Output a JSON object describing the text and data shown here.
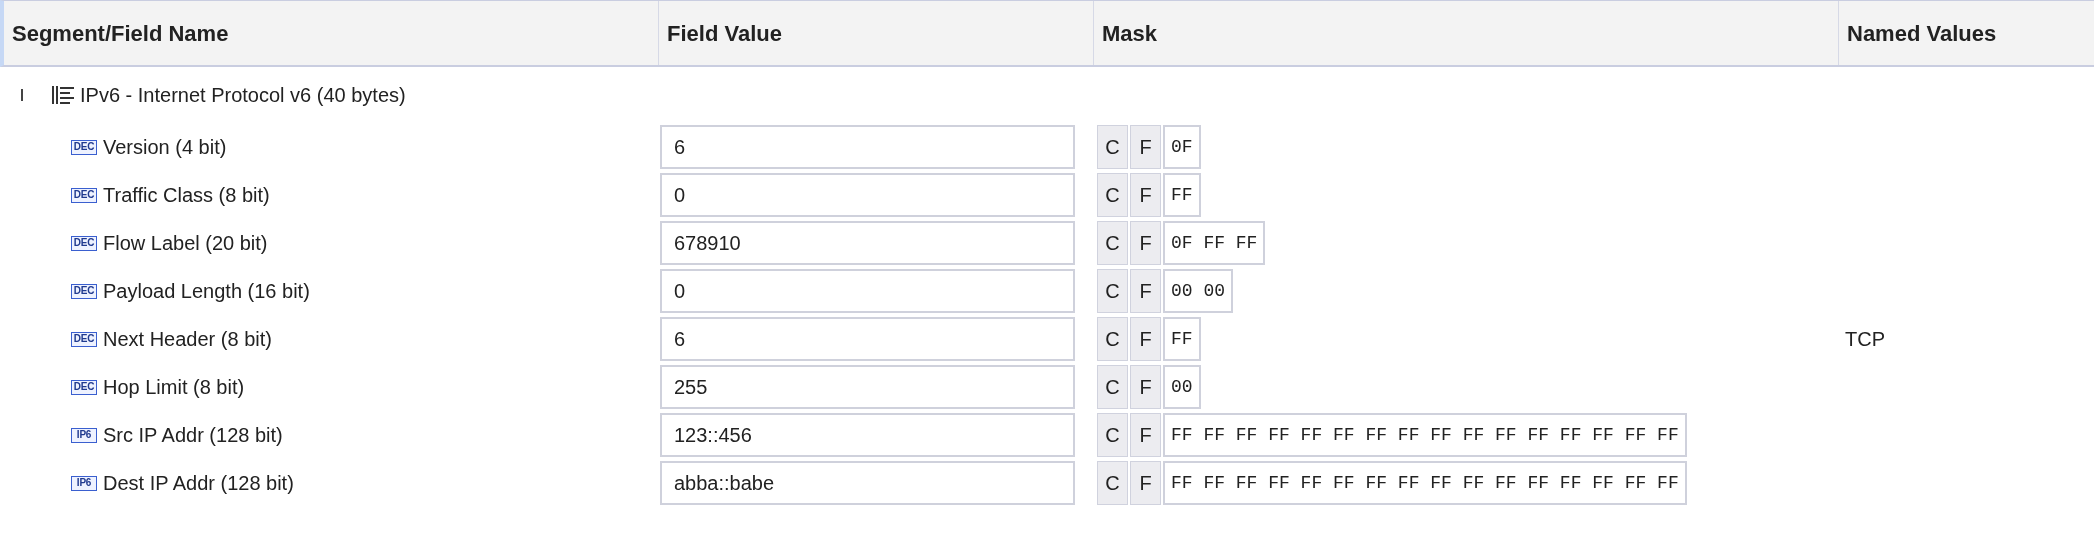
{
  "table": {
    "columns": [
      "Segment/Field Name",
      "Field Value",
      "Mask",
      "Named Values"
    ],
    "segment": {
      "name": "IPv6 - Internet Protocol v6 (40 bytes)",
      "expanded": true,
      "fields": [
        {
          "badge": "DEC",
          "name": "Version (4 bit)",
          "value": "6",
          "mask_buttons": [
            "C",
            "F"
          ],
          "mask": "0F"
        },
        {
          "badge": "DEC",
          "name": "Traffic Class (8 bit)",
          "value": "0",
          "mask_buttons": [
            "C",
            "F"
          ],
          "mask": "FF"
        },
        {
          "badge": "DEC",
          "name": "Flow Label (20 bit)",
          "value": "678910",
          "mask_buttons": [
            "C",
            "F"
          ],
          "mask": "0F FF FF"
        },
        {
          "badge": "DEC",
          "name": "Payload Length (16 bit)",
          "value": "0",
          "mask_buttons": [
            "C",
            "F"
          ],
          "mask": "00 00"
        },
        {
          "badge": "DEC",
          "name": "Next Header (8 bit)",
          "value": "6",
          "mask_buttons": [
            "C",
            "F"
          ],
          "mask": "FF",
          "named_value": "TCP"
        },
        {
          "badge": "DEC",
          "name": "Hop Limit (8 bit)",
          "value": "255",
          "mask_buttons": [
            "C",
            "F"
          ],
          "mask": "00"
        },
        {
          "badge": "IP6",
          "name": "Src IP Addr (128 bit)",
          "value": "123::456",
          "mask_buttons": [
            "C",
            "F"
          ],
          "mask": "FF FF FF FF FF FF FF FF FF FF FF FF FF FF FF FF"
        },
        {
          "badge": "IP6",
          "name": "Dest IP Addr (128 bit)",
          "value": "abba::babe",
          "mask_buttons": [
            "C",
            "F"
          ],
          "mask": "FF FF FF FF FF FF FF FF FF FF FF FF FF FF FF FF"
        }
      ]
    }
  }
}
